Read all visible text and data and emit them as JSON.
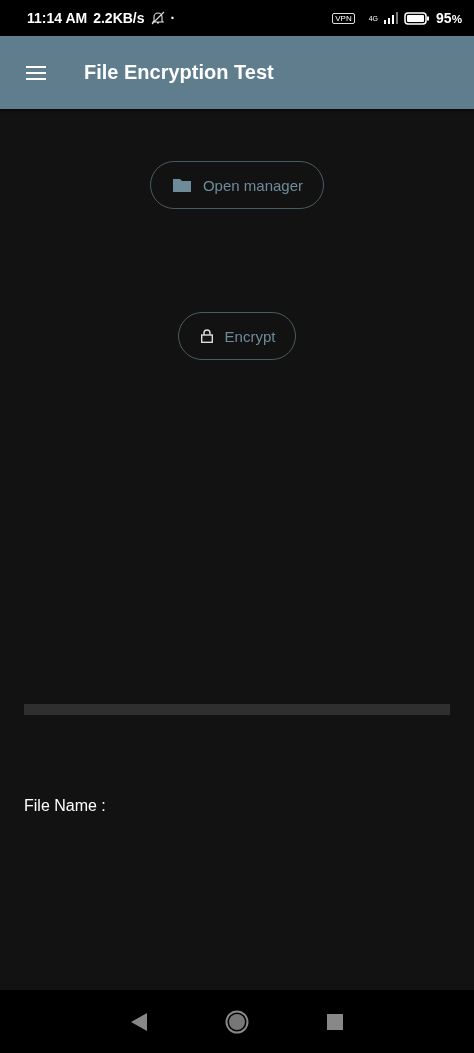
{
  "status_bar": {
    "time": "11:14 AM",
    "speed": "2.2KB/s",
    "dot": "·",
    "vpn": "VPN",
    "network": "4G",
    "battery": "95",
    "battery_unit": "%"
  },
  "app_bar": {
    "title": "File Encryption Test"
  },
  "buttons": [
    {
      "kind": "folder",
      "label": "Open manager"
    },
    {
      "kind": "lock",
      "label": "Encrypt"
    }
  ],
  "progress": {
    "level": 0
  },
  "file_name_label": "File Name :"
}
